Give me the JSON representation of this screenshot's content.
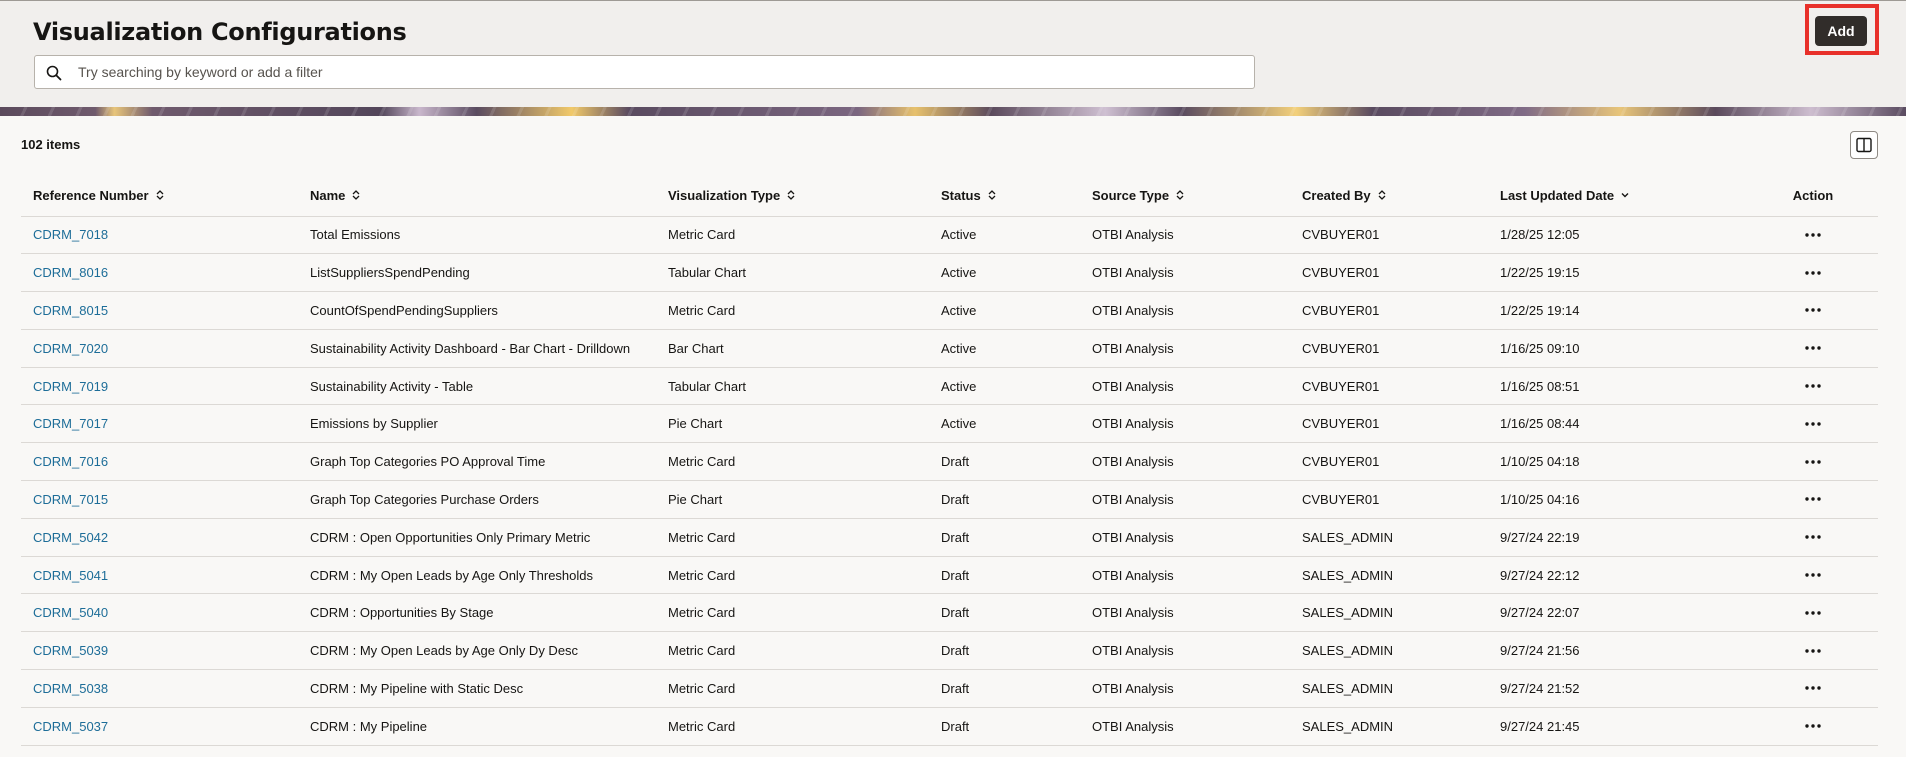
{
  "header": {
    "title": "Visualization Configurations",
    "search_placeholder": "Try searching by keyword or add a filter",
    "add_label": "Add"
  },
  "list": {
    "items_count": "102 items"
  },
  "table": {
    "columns": [
      {
        "label": "Reference Number",
        "sort": "both"
      },
      {
        "label": "Name",
        "sort": "both"
      },
      {
        "label": "Visualization Type",
        "sort": "both"
      },
      {
        "label": "Status",
        "sort": "both"
      },
      {
        "label": "Source Type",
        "sort": "both"
      },
      {
        "label": "Created By",
        "sort": "both"
      },
      {
        "label": "Last Updated Date",
        "sort": "desc"
      },
      {
        "label": "Action",
        "sort": "none"
      }
    ],
    "rows": [
      {
        "ref": "CDRM_7018",
        "name": "Total Emissions",
        "type": "Metric Card",
        "status": "Active",
        "source": "OTBI Analysis",
        "created_by": "CVBUYER01",
        "updated": "1/28/25 12:05"
      },
      {
        "ref": "CDRM_8016",
        "name": "ListSuppliersSpendPending",
        "type": "Tabular Chart",
        "status": "Active",
        "source": "OTBI Analysis",
        "created_by": "CVBUYER01",
        "updated": "1/22/25 19:15"
      },
      {
        "ref": "CDRM_8015",
        "name": "CountOfSpendPendingSuppliers",
        "type": "Metric Card",
        "status": "Active",
        "source": "OTBI Analysis",
        "created_by": "CVBUYER01",
        "updated": "1/22/25 19:14"
      },
      {
        "ref": "CDRM_7020",
        "name": "Sustainability Activity Dashboard - Bar Chart - Drilldown",
        "type": "Bar Chart",
        "status": "Active",
        "source": "OTBI Analysis",
        "created_by": "CVBUYER01",
        "updated": "1/16/25 09:10"
      },
      {
        "ref": "CDRM_7019",
        "name": "Sustainability Activity - Table",
        "type": "Tabular Chart",
        "status": "Active",
        "source": "OTBI Analysis",
        "created_by": "CVBUYER01",
        "updated": "1/16/25 08:51"
      },
      {
        "ref": "CDRM_7017",
        "name": "Emissions by Supplier",
        "type": "Pie Chart",
        "status": "Active",
        "source": "OTBI Analysis",
        "created_by": "CVBUYER01",
        "updated": "1/16/25 08:44"
      },
      {
        "ref": "CDRM_7016",
        "name": "Graph Top Categories PO Approval Time",
        "type": "Metric Card",
        "status": "Draft",
        "source": "OTBI Analysis",
        "created_by": "CVBUYER01",
        "updated": "1/10/25 04:18"
      },
      {
        "ref": "CDRM_7015",
        "name": "Graph Top Categories Purchase Orders",
        "type": "Pie Chart",
        "status": "Draft",
        "source": "OTBI Analysis",
        "created_by": "CVBUYER01",
        "updated": "1/10/25 04:16"
      },
      {
        "ref": "CDRM_5042",
        "name": "CDRM : Open Opportunities Only Primary Metric",
        "type": "Metric Card",
        "status": "Draft",
        "source": "OTBI Analysis",
        "created_by": "SALES_ADMIN",
        "updated": "9/27/24 22:19"
      },
      {
        "ref": "CDRM_5041",
        "name": "CDRM : My Open Leads by Age Only Thresholds",
        "type": "Metric Card",
        "status": "Draft",
        "source": "OTBI Analysis",
        "created_by": "SALES_ADMIN",
        "updated": "9/27/24 22:12"
      },
      {
        "ref": "CDRM_5040",
        "name": "CDRM : Opportunities By Stage",
        "type": "Metric Card",
        "status": "Draft",
        "source": "OTBI Analysis",
        "created_by": "SALES_ADMIN",
        "updated": "9/27/24 22:07"
      },
      {
        "ref": "CDRM_5039",
        "name": "CDRM : My Open Leads by Age Only Dy Desc",
        "type": "Metric Card",
        "status": "Draft",
        "source": "OTBI Analysis",
        "created_by": "SALES_ADMIN",
        "updated": "9/27/24 21:56"
      },
      {
        "ref": "CDRM_5038",
        "name": "CDRM : My Pipeline with Static Desc",
        "type": "Metric Card",
        "status": "Draft",
        "source": "OTBI Analysis",
        "created_by": "SALES_ADMIN",
        "updated": "9/27/24 21:52"
      },
      {
        "ref": "CDRM_5037",
        "name": "CDRM : My Pipeline",
        "type": "Metric Card",
        "status": "Draft",
        "source": "OTBI Analysis",
        "created_by": "SALES_ADMIN",
        "updated": "9/27/24 21:45"
      }
    ]
  },
  "icons": {
    "search": "search-icon",
    "columns": "columns-icon",
    "sort": "sort-icon",
    "sort_desc": "sort-desc-icon",
    "more": "more-horizontal-icon"
  },
  "colors": {
    "link": "#1d6d98",
    "add_button": "#312d2a",
    "highlight": "#e8302a"
  }
}
